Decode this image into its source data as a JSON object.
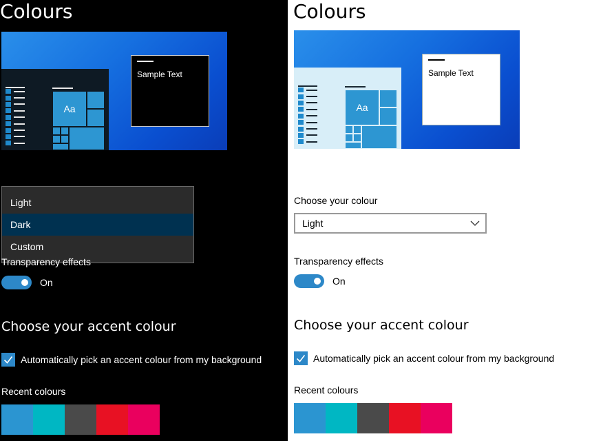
{
  "dark": {
    "title": "Colours",
    "preview": {
      "sample_text": "Sample Text",
      "tile_label": "Aa"
    },
    "colour_dropdown": {
      "options": [
        "Light",
        "Dark",
        "Custom"
      ],
      "highlighted": "Dark"
    },
    "transparency": {
      "label": "Transparency effects",
      "state": "On"
    },
    "accent": {
      "heading": "Choose your accent colour",
      "auto_pick_label": "Automatically pick an accent colour from my background",
      "auto_pick_checked": true,
      "recent_label": "Recent colours"
    }
  },
  "light": {
    "title": "Colours",
    "preview": {
      "sample_text": "Sample Text",
      "tile_label": "Aa"
    },
    "colour_select": {
      "label": "Choose your colour",
      "value": "Light"
    },
    "transparency": {
      "label": "Transparency effects",
      "state": "On"
    },
    "accent": {
      "heading": "Choose your accent colour",
      "auto_pick_label": "Automatically pick an accent colour from my background",
      "auto_pick_checked": true,
      "recent_label": "Recent colours"
    }
  },
  "recent_colours": [
    "#2b95d1",
    "#00b7c3",
    "#4a4a4a",
    "#e81123",
    "#ea005e"
  ],
  "accent_color": "#2d88c8"
}
